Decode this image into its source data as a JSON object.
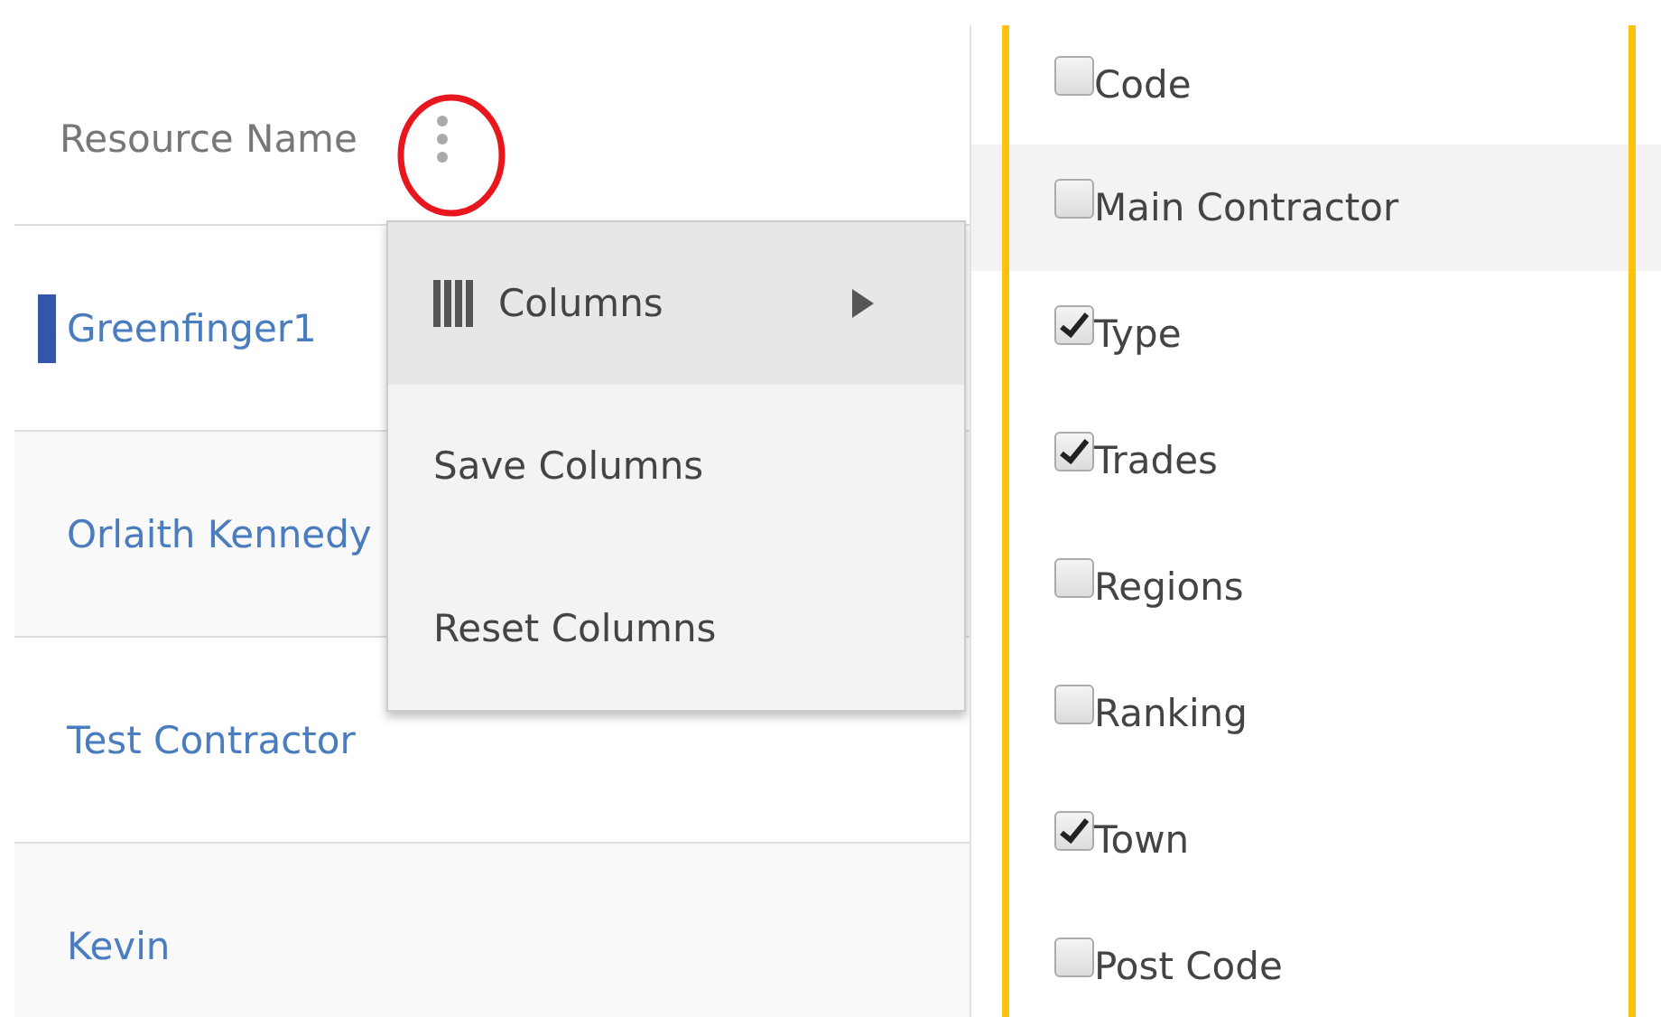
{
  "table": {
    "header": "Resource Name",
    "rows": [
      {
        "name": "Greenfinger1",
        "selected": true
      },
      {
        "name": "Orlaith Kennedy",
        "selected": false
      },
      {
        "name": "Test Contractor",
        "selected": false
      },
      {
        "name": "Kevin",
        "selected": false
      }
    ]
  },
  "menu": {
    "items": [
      {
        "label": "Columns",
        "kind": "submenu",
        "highlighted": true
      },
      {
        "label": "Save Columns",
        "kind": "action",
        "highlighted": false
      },
      {
        "label": "Reset Columns",
        "kind": "action",
        "highlighted": false
      }
    ]
  },
  "columns_panel": {
    "items": [
      {
        "label": "Code",
        "checked": false,
        "highlighted": false
      },
      {
        "label": "Main Contractor",
        "checked": false,
        "highlighted": true
      },
      {
        "label": "Type",
        "checked": true,
        "highlighted": false
      },
      {
        "label": "Trades",
        "checked": true,
        "highlighted": false
      },
      {
        "label": "Regions",
        "checked": false,
        "highlighted": false
      },
      {
        "label": "Ranking",
        "checked": false,
        "highlighted": false
      },
      {
        "label": "Town",
        "checked": true,
        "highlighted": false
      },
      {
        "label": "Post Code",
        "checked": false,
        "highlighted": false
      }
    ]
  }
}
